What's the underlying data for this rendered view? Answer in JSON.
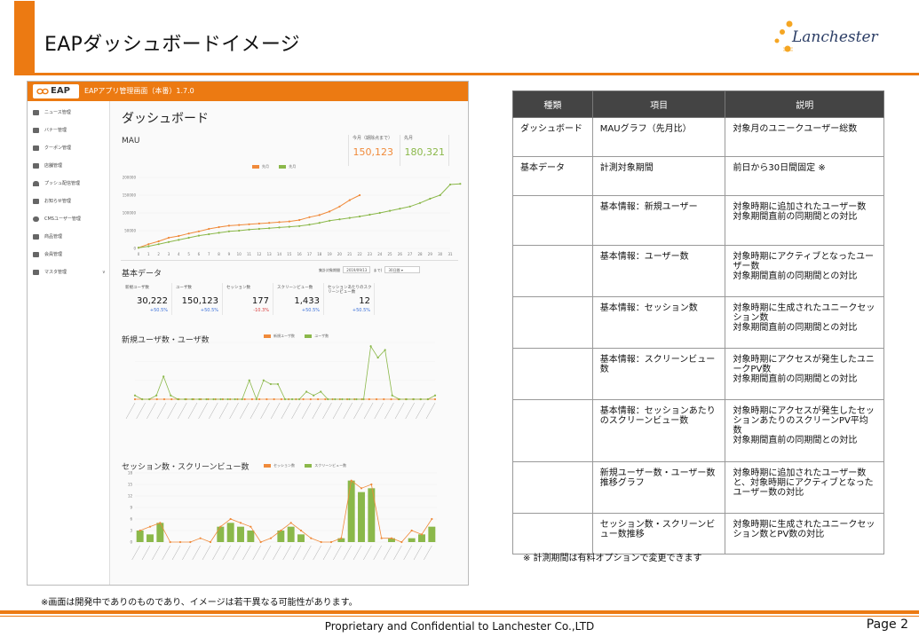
{
  "slide": {
    "title": "EAPダッシュボードイメージ",
    "brand": "Lanchester",
    "footer": "Proprietary and Confidential to Lanchester Co.,LTD",
    "page": "Page 2",
    "screen_note": "※画面は開発中でありのものであり、イメージは若干異なる可能性があります。",
    "accent_color": "#ec7a12"
  },
  "app": {
    "logo": "EAP",
    "title": "EAPアプリ管理画面（本番）1.7.0",
    "sidebar": [
      {
        "label": "ニュース管理",
        "icon": "news-icon"
      },
      {
        "label": "バナー管理",
        "icon": "banner-icon"
      },
      {
        "label": "クーポン管理",
        "icon": "coupon-icon"
      },
      {
        "label": "店舗管理",
        "icon": "store-icon"
      },
      {
        "label": "プッシュ配信管理",
        "icon": "bell-icon"
      },
      {
        "label": "お知らせ管理",
        "icon": "notice-icon"
      },
      {
        "label": "CMSユーザー管理",
        "icon": "user-icon"
      },
      {
        "label": "商品管理",
        "icon": "cart-icon"
      },
      {
        "label": "会員管理",
        "icon": "members-icon"
      },
      {
        "label": "マスタ管理",
        "icon": "master-icon"
      }
    ],
    "dashboard_title": "ダッシュボード",
    "mau": {
      "label": "MAU",
      "current_label": "今月（期除点まで）",
      "current_value": "150,123",
      "prev_label": "先月",
      "prev_value": "180,321",
      "legend_current": "先月",
      "legend_prev": "先月"
    },
    "basic_data": {
      "label": "基本データ",
      "period_label": "集計対象期間",
      "period_start": "2019/09/13",
      "period_mid": "まで(",
      "period_select": "30日間",
      "cards": [
        {
          "label": "新規ユーザ数",
          "value": "30,222",
          "delta": "+50.5%",
          "color": "#3a6fd8"
        },
        {
          "label": "ユーザ数",
          "value": "150,123",
          "delta": "+50.5%",
          "color": "#3a6fd8"
        },
        {
          "label": "セッション数",
          "value": "177",
          "delta": "-10.3%",
          "color": "#d83a3a"
        },
        {
          "label": "スクリーンビュー数",
          "value": "1,433",
          "delta": "+50.5%",
          "color": "#3a6fd8"
        },
        {
          "label": "セッションあたりのスクリーンビュー数",
          "value": "12",
          "delta": "+50.5%",
          "color": "#3a6fd8"
        }
      ]
    },
    "users_chart": {
      "title": "新規ユーザ数・ユーザ数",
      "legend_a": "新規ユーザ数",
      "legend_b": "ユーザ数"
    },
    "session_chart": {
      "title": "セッション数・スクリーンビュー数",
      "legend_a": "セッション数",
      "legend_b": "スクリーンビュー数"
    }
  },
  "table": {
    "headers": [
      "種類",
      "項目",
      "説明"
    ],
    "rows": [
      {
        "kind": "ダッシュボード",
        "item": "MAUグラフ（先月比）",
        "desc": "対象月のユニークユーザー総数"
      },
      {
        "kind": "基本データ",
        "item": "計測対象期間",
        "desc": "前日から30日間固定 ※"
      },
      {
        "kind": "",
        "item": "基本情報：新規ユーザー",
        "desc": "対象時期に追加されたユーザー数\n対象期間直前の同期間との対比"
      },
      {
        "kind": "",
        "item": "基本情報：ユーザー数",
        "desc": "対象時期にアクティブとなったユーザー数\n対象期間直前の同期間との対比"
      },
      {
        "kind": "",
        "item": "基本情報：セッション数",
        "desc": "対象時期に生成されたユニークセッション数\n対象期間直前の同期間との対比"
      },
      {
        "kind": "",
        "item": "基本情報：スクリーンビュー数",
        "desc": "対象時期にアクセスが発生したユニークPV数\n対象期間直前の同期間との対比"
      },
      {
        "kind": "",
        "item": "基本情報：セッションあたりのスクリーンビュー数",
        "desc": "対象時期にアクセスが発生したセッションあたりのスクリーンPV平均数\n対象期間直前の同期間との対比"
      },
      {
        "kind": "",
        "item": "新規ユーザー数・ユーザー数推移グラフ",
        "desc": "対象時期に追加されたユーザー数と、対象時期にアクティブとなったユーザー数の対比"
      },
      {
        "kind": "",
        "item": "セッション数・スクリーンビュー数推移",
        "desc": "対象時期に生成されたユニークセッション数とPV数の対比"
      }
    ],
    "note": "※ 計測期間は有料オプションで変更できます"
  },
  "chart_data": [
    {
      "type": "line",
      "title": "MAU",
      "x": [
        0,
        1,
        2,
        3,
        4,
        5,
        6,
        7,
        8,
        9,
        10,
        11,
        12,
        13,
        14,
        15,
        16,
        17,
        18,
        19,
        20,
        21,
        22,
        23,
        24,
        25,
        26,
        27,
        28,
        29,
        30,
        31
      ],
      "series": [
        {
          "name": "先月",
          "color": "#f08a3a",
          "values": [
            2000,
            12000,
            20000,
            30000,
            35000,
            42000,
            48000,
            55000,
            60000,
            64000,
            66000,
            68000,
            70000,
            72000,
            74000,
            76000,
            80000,
            88000,
            94000,
            104000,
            118000,
            136000,
            150000
          ]
        },
        {
          "name": "先月",
          "color": "#8bb84a",
          "values": [
            2000,
            6000,
            12000,
            18000,
            24000,
            30000,
            36000,
            40000,
            44000,
            48000,
            50000,
            53000,
            55000,
            57000,
            59000,
            61000,
            63000,
            67000,
            72000,
            78000,
            82000,
            86000,
            90000,
            95000,
            100000,
            106000,
            112000,
            118000,
            128000,
            140000,
            150000,
            180000,
            182000
          ]
        }
      ],
      "ylim": [
        0,
        200000
      ]
    },
    {
      "type": "line",
      "title": "新規ユーザ数・ユーザ数",
      "series": [
        {
          "name": "新規ユーザ数",
          "color": "#f08a3a",
          "values": [
            0,
            0,
            0,
            0,
            0,
            0,
            0,
            0,
            0,
            0,
            0,
            0,
            0,
            0,
            0,
            0,
            0,
            0,
            0,
            0,
            0,
            0,
            0,
            0,
            0,
            0,
            0,
            0,
            0,
            0,
            0,
            0,
            0,
            0,
            0,
            0,
            0,
            0,
            0,
            0,
            0,
            0
          ]
        },
        {
          "name": "ユーザ数",
          "color": "#8bb84a",
          "values": [
            1,
            0,
            0,
            1,
            6,
            1,
            0,
            0,
            0,
            0,
            0,
            0,
            0,
            0,
            0,
            0,
            5,
            0,
            5,
            4,
            4,
            0,
            0,
            0,
            2,
            1,
            2,
            0,
            0,
            0,
            0,
            0,
            0,
            14,
            11,
            13,
            1,
            0,
            0,
            0,
            0,
            0,
            1
          ]
        }
      ]
    },
    {
      "type": "bar",
      "title": "セッション数・スクリーンビュー数",
      "series": [
        {
          "name": "セッション数",
          "color": "#f08a3a",
          "values": [
            3,
            4,
            5,
            0,
            0,
            0,
            1,
            0,
            4,
            6,
            5,
            4,
            0,
            1,
            3,
            5,
            3,
            1,
            0,
            0,
            1,
            16,
            14,
            15,
            1,
            1,
            0,
            3,
            2,
            6
          ]
        },
        {
          "name": "スクリーンビュー数",
          "color": "#8bb84a",
          "values": [
            3,
            2,
            5,
            0,
            0,
            0,
            0,
            0,
            4,
            5,
            4,
            3,
            0,
            0,
            3,
            4,
            2,
            0,
            0,
            0,
            1,
            16,
            13,
            14,
            0,
            1,
            0,
            1,
            2,
            4
          ]
        }
      ]
    }
  ]
}
